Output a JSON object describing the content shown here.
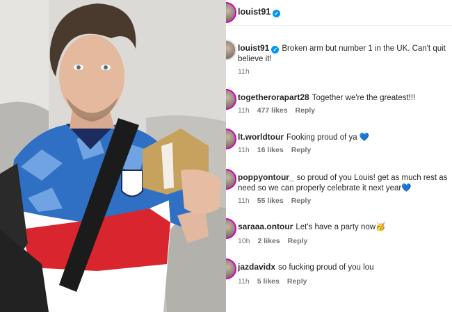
{
  "post": {
    "author": "louist91",
    "verified": true,
    "photo_alt_icon": "person-holding-award-photo"
  },
  "comments": [
    {
      "username": "louist91",
      "verified": true,
      "text": "Broken arm but number 1 in the UK. Can't quit believe it!",
      "time": "11h",
      "likes": "",
      "reply": ""
    },
    {
      "username": "togetherorapart28",
      "verified": false,
      "text": "Together we're the greatest!!!",
      "time": "11h",
      "likes": "477 likes",
      "reply": "Reply"
    },
    {
      "username": "lt.worldtour",
      "verified": false,
      "text": "Fooking proud of ya 💙",
      "time": "11h",
      "likes": "16 likes",
      "reply": "Reply"
    },
    {
      "username": "poppyontour_",
      "verified": false,
      "text": "so proud of you Louis! get as much rest as need so we can properly celebrate it next year💙",
      "time": "11h",
      "likes": "55 likes",
      "reply": "Reply"
    },
    {
      "username": "saraaa.ontour",
      "verified": false,
      "text": "Let's have a party now🥳",
      "time": "10h",
      "likes": "2 likes",
      "reply": "Reply"
    },
    {
      "username": "jazdavidx",
      "verified": false,
      "text": "so fucking proud of you lou",
      "time": "11h",
      "likes": "5 likes",
      "reply": "Reply"
    }
  ],
  "colors": {
    "story_ring": "#d300c5",
    "verified_badge": "#0095f6",
    "meta_text": "#737373"
  }
}
